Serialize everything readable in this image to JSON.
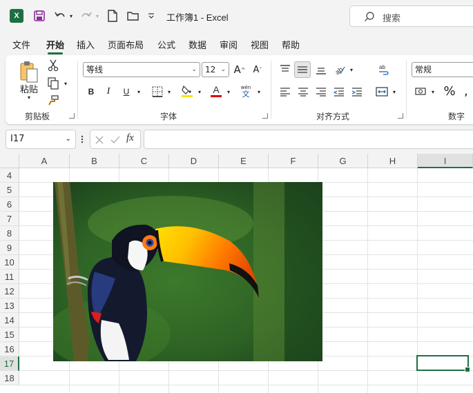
{
  "titlebar": {
    "title": "工作簿1  -  Excel",
    "search_placeholder": "搜索"
  },
  "menu": {
    "tabs": [
      {
        "label": "文件"
      },
      {
        "label": "开始"
      },
      {
        "label": "插入"
      },
      {
        "label": "页面布局"
      },
      {
        "label": "公式"
      },
      {
        "label": "数据"
      },
      {
        "label": "审阅"
      },
      {
        "label": "视图"
      },
      {
        "label": "帮助"
      }
    ],
    "active": "开始"
  },
  "ribbon": {
    "clipboard": {
      "paste_label": "粘贴",
      "group_label": "剪贴板"
    },
    "font": {
      "font_name": "等线",
      "font_size": "12",
      "group_label": "字体",
      "bold": "B",
      "italic": "I",
      "underline": "U",
      "phonetic_top": "wén",
      "phonetic_bottom": "文"
    },
    "alignment": {
      "group_label": "对齐方式"
    },
    "number": {
      "format": "常规",
      "percent": "%",
      "group_label": "数字"
    }
  },
  "formula_bar": {
    "name_box": "I17",
    "fx": "fx",
    "value": ""
  },
  "grid": {
    "columns": [
      "A",
      "B",
      "C",
      "D",
      "E",
      "F",
      "G",
      "H",
      "I"
    ],
    "rows": [
      "4",
      "5",
      "6",
      "7",
      "8",
      "9",
      "10",
      "11",
      "12",
      "13",
      "14",
      "15",
      "16",
      "17",
      "18"
    ],
    "selected_cell": "I17",
    "selected_column": "I",
    "selected_row": "17"
  },
  "picture": {
    "subject": "toucan-photo"
  },
  "colors": {
    "accent": "#1d6f42",
    "highlight_yellow": "#ffe000",
    "font_red": "#e00000"
  }
}
